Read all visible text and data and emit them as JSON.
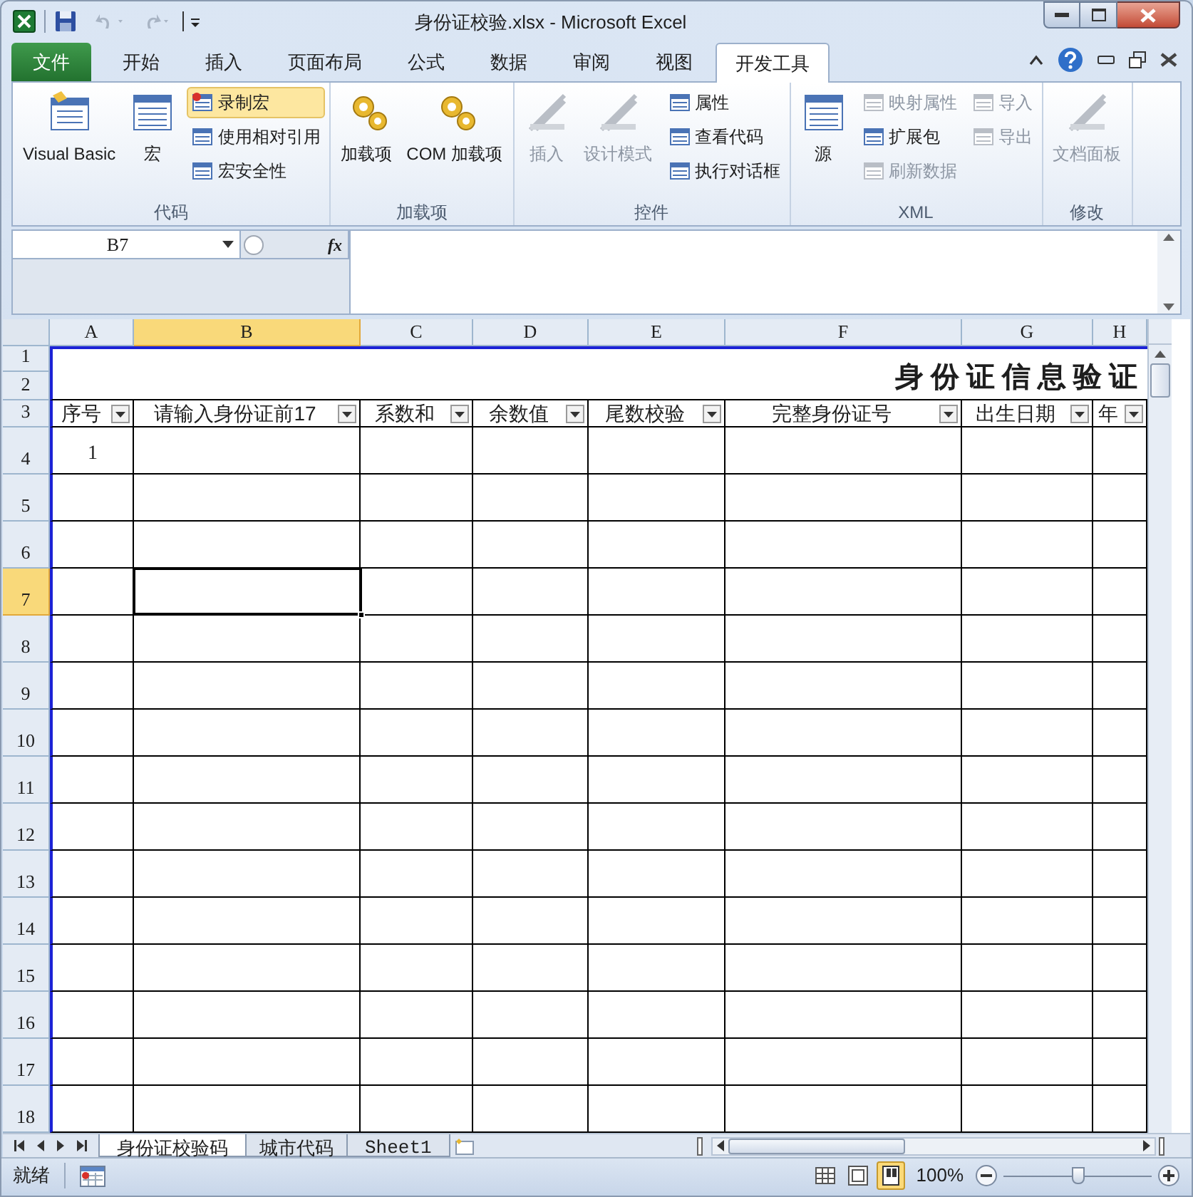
{
  "window": {
    "title": "身份证校验.xlsx  -  Microsoft Excel"
  },
  "ribbon_tabs": [
    {
      "label": "文件",
      "kind": "file",
      "selected": false
    },
    {
      "label": "开始",
      "kind": "tab",
      "selected": false
    },
    {
      "label": "插入",
      "kind": "tab",
      "selected": false
    },
    {
      "label": "页面布局",
      "kind": "tab",
      "selected": false
    },
    {
      "label": "公式",
      "kind": "tab",
      "selected": false
    },
    {
      "label": "数据",
      "kind": "tab",
      "selected": false
    },
    {
      "label": "审阅",
      "kind": "tab",
      "selected": false
    },
    {
      "label": "视图",
      "kind": "tab",
      "selected": false
    },
    {
      "label": "开发工具",
      "kind": "tab",
      "selected": true
    }
  ],
  "ribbon_groups": [
    {
      "label": "代码",
      "items": [
        {
          "label": "Visual Basic",
          "kind": "large",
          "disabled": false,
          "highlighted": false
        },
        {
          "label": "宏",
          "kind": "large",
          "disabled": false,
          "highlighted": false
        },
        {
          "label": "录制宏",
          "kind": "small",
          "disabled": false,
          "highlighted": true
        },
        {
          "label": "使用相对引用",
          "kind": "small",
          "disabled": false,
          "highlighted": false
        },
        {
          "label": "宏安全性",
          "kind": "small",
          "disabled": false,
          "highlighted": false
        }
      ]
    },
    {
      "label": "加载项",
      "items": [
        {
          "label": "加载项",
          "kind": "large",
          "disabled": false,
          "highlighted": false
        },
        {
          "label": "COM 加载项",
          "kind": "large",
          "disabled": false,
          "highlighted": false
        }
      ]
    },
    {
      "label": "控件",
      "items": [
        {
          "label": "插入",
          "kind": "large",
          "disabled": true,
          "highlighted": false
        },
        {
          "label": "设计模式",
          "kind": "large",
          "disabled": true,
          "highlighted": false
        },
        {
          "label": "属性",
          "kind": "small",
          "disabled": false,
          "highlighted": false
        },
        {
          "label": "查看代码",
          "kind": "small",
          "disabled": false,
          "highlighted": false
        },
        {
          "label": "执行对话框",
          "kind": "small",
          "disabled": false,
          "highlighted": false
        }
      ]
    },
    {
      "label": "XML",
      "items": [
        {
          "label": "源",
          "kind": "large",
          "disabled": false,
          "highlighted": false
        },
        {
          "label": "映射属性",
          "kind": "small",
          "disabled": true,
          "highlighted": false
        },
        {
          "label": "扩展包",
          "kind": "small",
          "disabled": false,
          "highlighted": false
        },
        {
          "label": "刷新数据",
          "kind": "small",
          "disabled": true,
          "highlighted": false
        },
        {
          "label": "导入",
          "kind": "small",
          "disabled": true,
          "highlighted": false
        },
        {
          "label": "导出",
          "kind": "small",
          "disabled": true,
          "highlighted": false
        }
      ]
    },
    {
      "label": "修改",
      "items": [
        {
          "label": "文档面板",
          "kind": "large",
          "disabled": true,
          "highlighted": false
        }
      ]
    }
  ],
  "formula_bar": {
    "name_box": "B7",
    "function_label": "fx"
  },
  "sheet": {
    "columns": [
      {
        "label": "A",
        "selected": false
      },
      {
        "label": "B",
        "selected": true
      },
      {
        "label": "C",
        "selected": false
      },
      {
        "label": "D",
        "selected": false
      },
      {
        "label": "E",
        "selected": false
      },
      {
        "label": "F",
        "selected": false
      },
      {
        "label": "G",
        "selected": false
      },
      {
        "label": "H",
        "selected": false
      }
    ],
    "rows": [
      {
        "label": "1",
        "selected": false
      },
      {
        "label": "2",
        "selected": false
      },
      {
        "label": "3",
        "selected": false
      },
      {
        "label": "4",
        "selected": false,
        "cells": [
          "1"
        ]
      },
      {
        "label": "5",
        "selected": false
      },
      {
        "label": "6",
        "selected": false
      },
      {
        "label": "7",
        "selected": true
      },
      {
        "label": "8",
        "selected": false
      },
      {
        "label": "9",
        "selected": false
      },
      {
        "label": "10",
        "selected": false
      },
      {
        "label": "11",
        "selected": false
      },
      {
        "label": "12",
        "selected": false
      },
      {
        "label": "13",
        "selected": false
      },
      {
        "label": "14",
        "selected": false
      },
      {
        "label": "15",
        "selected": false
      },
      {
        "label": "16",
        "selected": false
      },
      {
        "label": "17",
        "selected": false
      },
      {
        "label": "18",
        "selected": false
      }
    ],
    "title": "身份证信息验证",
    "header_cells": [
      "序号",
      "请输入身份证前17",
      "系数和",
      "余数值",
      "尾数校验",
      "完整身份证号",
      "出生日期",
      "年"
    ]
  },
  "sheet_tabs": [
    {
      "label": "身份证校验码",
      "selected": true
    },
    {
      "label": "城市代码",
      "selected": false
    },
    {
      "label": "Sheet1",
      "selected": false
    }
  ],
  "status_bar": {
    "status": "就绪",
    "views": [
      {
        "kind": "normal",
        "selected": false
      },
      {
        "kind": "page-layout",
        "selected": false
      },
      {
        "kind": "page-break",
        "selected": true
      }
    ],
    "zoom": "100%",
    "zoom_slider": {
      "level": 0.5
    }
  }
}
